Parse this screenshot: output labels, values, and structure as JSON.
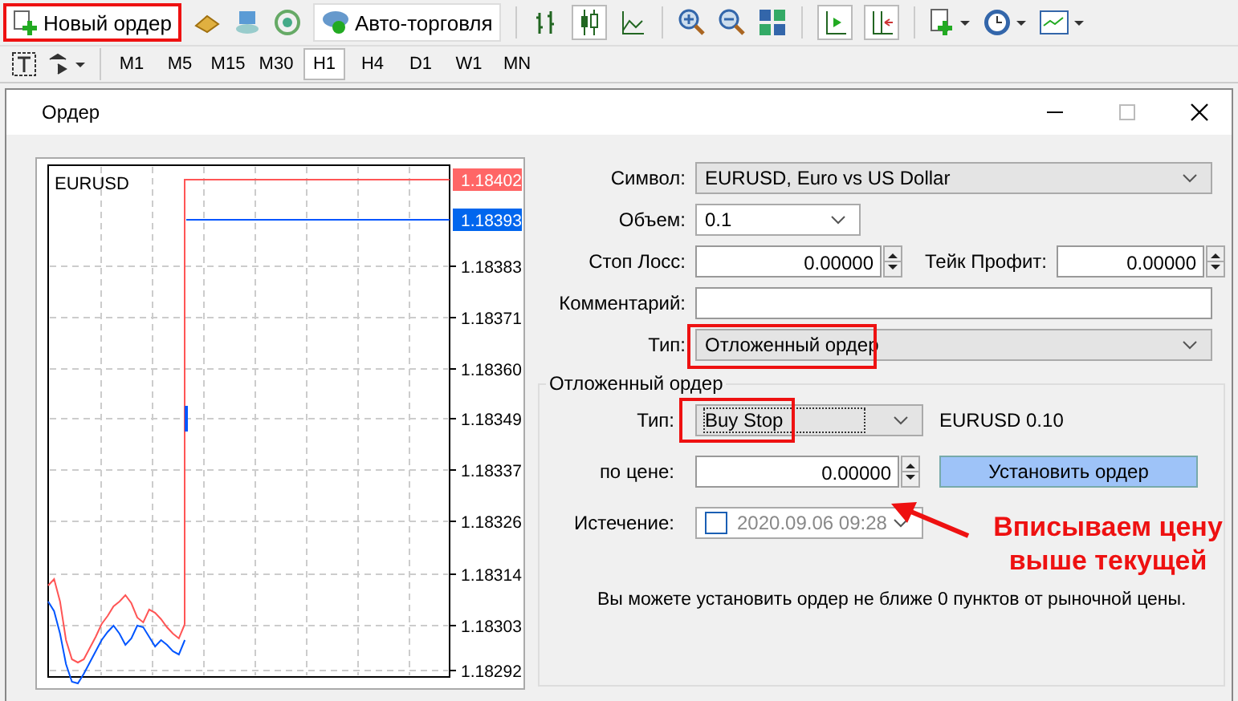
{
  "toolbar": {
    "new_order": {
      "label": "Новый ордер",
      "highlighted": true
    },
    "auto_trading": {
      "label": "Авто-торговля"
    }
  },
  "timeframes": [
    {
      "label": "M1",
      "selected": false
    },
    {
      "label": "M5",
      "selected": false
    },
    {
      "label": "M15",
      "selected": false
    },
    {
      "label": "M30",
      "selected": false
    },
    {
      "label": "H1",
      "selected": true
    },
    {
      "label": "H4",
      "selected": false
    },
    {
      "label": "D1",
      "selected": false
    },
    {
      "label": "W1",
      "selected": false
    },
    {
      "label": "MN",
      "selected": false
    }
  ],
  "dialog": {
    "title": "Ордер",
    "chart": {
      "symbol": "EURUSD",
      "ask": "1.18402",
      "bid": "1.18393",
      "price_labels": [
        "1.18383",
        "1.18371",
        "1.18360",
        "1.18349",
        "1.18337",
        "1.18326",
        "1.18314",
        "1.18303",
        "1.18292"
      ]
    },
    "symbol": {
      "label": "Символ:",
      "value": "EURUSD, Euro vs US Dollar"
    },
    "volume": {
      "label": "Объем:",
      "value": "0.1"
    },
    "stop_loss": {
      "label": "Стоп Лосс:",
      "value": "0.00000"
    },
    "take_profit": {
      "label": "Тейк Профит:",
      "value": "0.00000"
    },
    "comment": {
      "label": "Комментарий:"
    },
    "type": {
      "label": "Тип:",
      "value": "Отложенный ордер",
      "highlighted": true
    },
    "pending": {
      "title": "Отложенный ордер",
      "type": {
        "label": "Тип:",
        "value": "Buy Stop",
        "highlighted": true
      },
      "lot_info": "EURUSD 0.10",
      "price": {
        "label": "по цене:",
        "value": "0.00000"
      },
      "place_button": "Установить ордер",
      "expiration": {
        "label": "Истечение:",
        "value": "2020.09.06 09:28",
        "checked": false,
        "disabled": true
      },
      "note": "Вы можете установить ордер не ближе 0 пунктов от рыночной цены."
    },
    "annotation": "Вписываем цену выше текущей"
  }
}
